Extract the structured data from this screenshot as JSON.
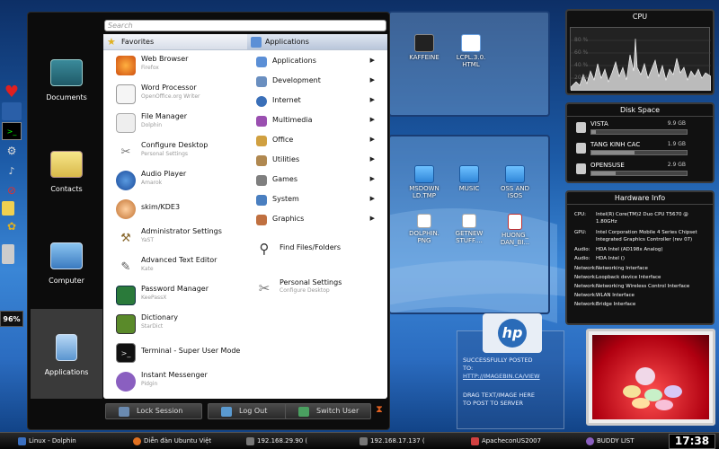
{
  "menu": {
    "search_placeholder": "Search",
    "categories": [
      {
        "label": "Documents",
        "icon": "typewriter-icon"
      },
      {
        "label": "Contacts",
        "icon": "contacts-icon"
      },
      {
        "label": "Computer",
        "icon": "computer-icon"
      },
      {
        "label": "Applications",
        "icon": "applications-icon"
      }
    ],
    "favorites_header": "Favorites",
    "applications_header": "Applications",
    "favorites": [
      {
        "title": "Web Browser",
        "subtitle": "Firefox",
        "icon": "firefox-icon"
      },
      {
        "title": "Word Processor",
        "subtitle": "OpenOffice.org Writer",
        "icon": "word-processor-icon"
      },
      {
        "title": "File Manager",
        "subtitle": "Dolphin",
        "icon": "file-manager-icon"
      },
      {
        "title": "Configure Desktop",
        "subtitle": "Personal Settings",
        "icon": "configure-desktop-icon"
      },
      {
        "title": "Audio Player",
        "subtitle": "Amarok",
        "icon": "audio-player-icon"
      },
      {
        "title": "skim/KDE3",
        "subtitle": "",
        "icon": "skim-icon"
      },
      {
        "title": "Administrator Settings",
        "subtitle": "YaST",
        "icon": "admin-settings-icon"
      },
      {
        "title": "Advanced Text Editor",
        "subtitle": "Kate",
        "icon": "text-editor-icon"
      },
      {
        "title": "Password Manager",
        "subtitle": "KeePassX",
        "icon": "password-manager-icon"
      },
      {
        "title": "Dictionary",
        "subtitle": "StarDict",
        "icon": "dictionary-icon"
      },
      {
        "title": "Terminal - Super User Mode",
        "subtitle": "",
        "icon": "terminal-icon"
      },
      {
        "title": "Instant Messenger",
        "subtitle": "Pidgin",
        "icon": "messenger-icon"
      }
    ],
    "app_categories": [
      {
        "label": "Applications",
        "icon": "applications-folder-icon",
        "color": "#5b8fd6"
      },
      {
        "label": "Development",
        "icon": "development-icon",
        "color": "#6a8fc0"
      },
      {
        "label": "Internet",
        "icon": "internet-icon",
        "color": "#3a6fb8"
      },
      {
        "label": "Multimedia",
        "icon": "multimedia-icon",
        "color": "#9a4fb0"
      },
      {
        "label": "Office",
        "icon": "office-icon",
        "color": "#d0a040"
      },
      {
        "label": "Utilities",
        "icon": "utilities-icon",
        "color": "#b08850"
      },
      {
        "label": "Games",
        "icon": "games-icon",
        "color": "#7f7f7f"
      },
      {
        "label": "System",
        "icon": "system-icon",
        "color": "#4a7fc0"
      },
      {
        "label": "Graphics",
        "icon": "graphics-icon",
        "color": "#c07040"
      }
    ],
    "find_files": "Find Files/Folders",
    "personal_settings": {
      "title": "Personal Settings",
      "subtitle": "Configure Desktop"
    },
    "buttons": {
      "lock": "Lock Session",
      "logout": "Log Out",
      "switch_user": "Switch User"
    }
  },
  "desktop_icons": [
    {
      "label": "KAFFEINE",
      "icon": "kaffeine-icon"
    },
    {
      "label": "LCPL.3.0.\nHTML",
      "icon": "html-file-icon"
    },
    {
      "label": "MSDOWN\nLD.TMP",
      "icon": "folder-icon"
    },
    {
      "label": "MUSIC",
      "icon": "folder-icon"
    },
    {
      "label": "OSS AND\nISOS",
      "icon": "folder-icon"
    },
    {
      "label": "DOLPHIN.\nPNG",
      "icon": "image-file-icon"
    },
    {
      "label": "GETNEW\nSTUFF....",
      "icon": "image-file-icon"
    },
    {
      "label": "HUONG_\nDAN_BI...",
      "icon": "pdf-file-icon"
    }
  ],
  "imagebin": {
    "line1": "SUCCESSFULLY POSTED",
    "line2": "TO:",
    "link": "HTTP://IMAGEBIN.CA/VIEW",
    "line3": "DRAG TEXT/IMAGE HERE",
    "line4": "TO POST TO SERVER"
  },
  "cpu": {
    "title": "CPU",
    "labels": [
      "80 %",
      "60 %",
      "40 %",
      "20 %"
    ]
  },
  "disk": {
    "title": "Disk Space",
    "items": [
      {
        "name": "VISTA",
        "size": "9.9 GB",
        "used": 0.05
      },
      {
        "name": "TANG KINH CAC",
        "size": "1.9 GB",
        "used": 0.45
      },
      {
        "name": "OPENSUSE",
        "size": "2.9 GB",
        "used": 0.25
      }
    ]
  },
  "hardware": {
    "title": "Hardware Info",
    "rows": [
      {
        "key": "CPU:",
        "value": "Intel(R) Core(TM)2 Duo CPU T5670 @"
      },
      {
        "key": "",
        "value": "1.80GHz"
      },
      {
        "key": "GPU:",
        "value": "Intel Corporation Mobile 4 Series Chipset"
      },
      {
        "key": "",
        "value": "Integrated Graphics Controller (rev 07)"
      },
      {
        "key": "Audio:",
        "value": "HDA Intel (AD198x Analog)"
      },
      {
        "key": "Audio:",
        "value": "HDA Intel ()"
      },
      {
        "key": "Network:",
        "value": "Networking Interface"
      },
      {
        "key": "Network:",
        "value": "Loopback device Interface"
      },
      {
        "key": "Network:",
        "value": "Networking Wireless Control Interface"
      },
      {
        "key": "Network:",
        "value": "WLAN Interface"
      },
      {
        "key": "Network:",
        "value": "Bridge Interface"
      }
    ]
  },
  "dock": {
    "battery": "96%"
  },
  "taskbar": {
    "tasks": [
      {
        "label": "Linux - Dolphin",
        "color": "#3a6fc0"
      },
      {
        "label": "Diễn đàn Ubuntu Việt",
        "color": "#e07020"
      },
      {
        "label": "192.168.29.90 (",
        "color": "#444"
      },
      {
        "label": "192.168.17.137 (",
        "color": "#444"
      },
      {
        "label": "ApacheconUS2007",
        "color": "#d04040"
      },
      {
        "label": "BUDDY LIST",
        "color": "#8a5fc0"
      }
    ],
    "clock": "17:38"
  }
}
